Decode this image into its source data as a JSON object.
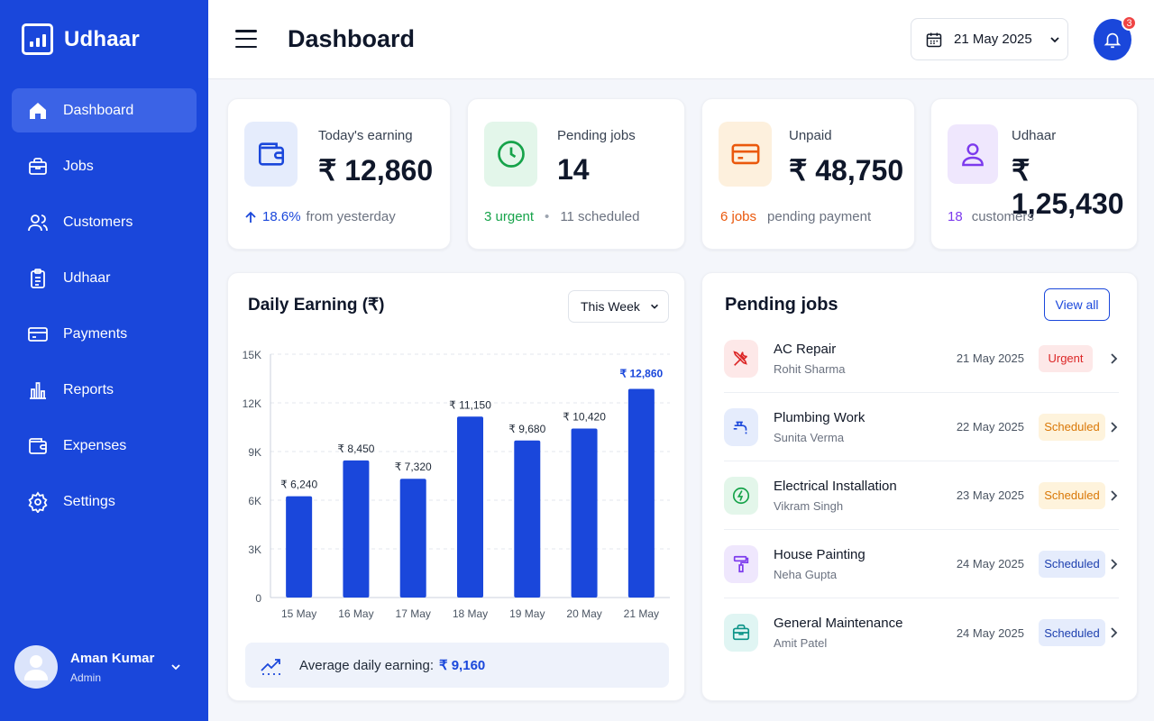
{
  "app": {
    "name": "Udhaar"
  },
  "sidebar": {
    "items": [
      {
        "label": "Dashboard",
        "icon": "home-icon",
        "active": true
      },
      {
        "label": "Jobs",
        "icon": "briefcase-icon"
      },
      {
        "label": "Customers",
        "icon": "users-icon"
      },
      {
        "label": "Udhaar",
        "icon": "clipboard-icon"
      },
      {
        "label": "Payments",
        "icon": "credit-card-icon"
      },
      {
        "label": "Reports",
        "icon": "bar-chart-icon"
      },
      {
        "label": "Expenses",
        "icon": "wallet-icon"
      },
      {
        "label": "Settings",
        "icon": "gear-icon"
      }
    ],
    "user": {
      "name": "Aman Kumar",
      "role": "Admin"
    }
  },
  "header": {
    "title": "Dashboard",
    "date": "21 May 2025",
    "notifications": "3"
  },
  "stats": [
    {
      "label": "Today's earning",
      "value": "₹ 12,860",
      "foot_value": "18.6%",
      "foot_text": "from yesterday",
      "icon": "wallet-icon",
      "accent": "#1a47db"
    },
    {
      "label": "Pending jobs",
      "value": "14",
      "foot_value": "3 urgent",
      "foot_sep": "•",
      "foot_text": "11 scheduled",
      "icon": "clock-icon",
      "accent": "#16a34a"
    },
    {
      "label": "Unpaid",
      "value": "₹ 48,750",
      "foot_value": "6 jobs",
      "foot_text": "pending payment",
      "icon": "credit-card-icon",
      "accent": "#ea580c"
    },
    {
      "label": "Udhaar",
      "value": "₹ 1,25,430",
      "foot_value": "18",
      "foot_text": "customers",
      "icon": "user-icon",
      "accent": "#7c3aed"
    }
  ],
  "chart": {
    "title": "Daily Earning (₹)",
    "range": "This Week",
    "avg_label": "Average daily earning:",
    "avg_value": "₹ 9,160"
  },
  "chart_data": {
    "type": "bar",
    "categories": [
      "15 May",
      "16 May",
      "17 May",
      "18 May",
      "19 May",
      "20 May",
      "21 May"
    ],
    "values": [
      6240,
      8450,
      7320,
      11150,
      9680,
      10420,
      12860
    ],
    "value_labels": [
      "₹ 6,240",
      "₹ 8,450",
      "₹ 7,320",
      "₹ 11,150",
      "₹ 9,680",
      "₹ 10,420",
      "₹ 12,860"
    ],
    "yticks": [
      "0",
      "3K",
      "6K",
      "9K",
      "12K",
      "15K"
    ],
    "ylim": [
      0,
      15000
    ],
    "grid": true,
    "bar_color": "#1a47db"
  },
  "jobs": {
    "title": "Pending jobs",
    "view_all": "View all",
    "items": [
      {
        "name": "AC Repair",
        "client": "Rohit Sharma",
        "date": "21 May 2025",
        "status": "Urgent",
        "icon": "tools-icon",
        "icon_bg": "#fde8e8",
        "icon_color": "#dc2626"
      },
      {
        "name": "Plumbing Work",
        "client": "Sunita Verma",
        "date": "22 May 2025",
        "status": "Scheduled",
        "icon": "faucet-icon",
        "icon_bg": "#e5ecfc",
        "icon_color": "#1a47db"
      },
      {
        "name": "Electrical Installation",
        "client": "Vikram Singh",
        "date": "23 May 2025",
        "status": "Scheduled",
        "icon": "bolt-icon",
        "icon_bg": "#e3f6ea",
        "icon_color": "#16a34a"
      },
      {
        "name": "House Painting",
        "client": "Neha Gupta",
        "date": "24 May 2025",
        "status": "Scheduled",
        "icon": "paint-roller-icon",
        "icon_bg": "#efe7fd",
        "icon_color": "#7c3aed"
      },
      {
        "name": "General Maintenance",
        "client": "Amit Patel",
        "date": "24 May 2025",
        "status": "Scheduled",
        "icon": "toolbox-icon",
        "icon_bg": "#e0f5f3",
        "icon_color": "#0d9488"
      }
    ]
  }
}
